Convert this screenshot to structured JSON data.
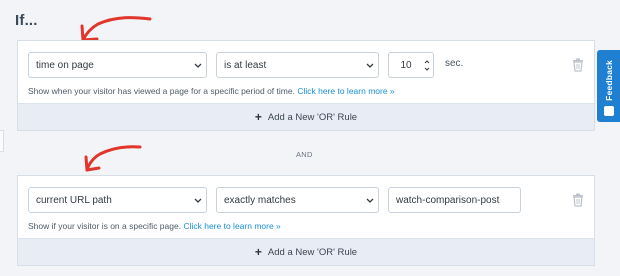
{
  "heading": "If...",
  "rules": [
    {
      "field": "time on page",
      "operator": "is at least",
      "value": "10",
      "unit": "sec.",
      "help_text": "Show when your visitor has viewed a page for a specific period of time.",
      "help_link": "Click here to learn more »",
      "add_or_label": "Add a New 'OR' Rule"
    },
    {
      "field": "current URL path",
      "operator": "exactly matches",
      "value": "watch-comparison-post",
      "help_text": "Show if your visitor is on a specific page.",
      "help_link": "Click here to learn more »",
      "add_or_label": "Add a New 'OR' Rule"
    }
  ],
  "and_label": "AND",
  "feedback_tab": "Feedback",
  "colors": {
    "arrow": "#e0362b",
    "link": "#1a8fd6",
    "feedback": "#1f7fd1"
  }
}
